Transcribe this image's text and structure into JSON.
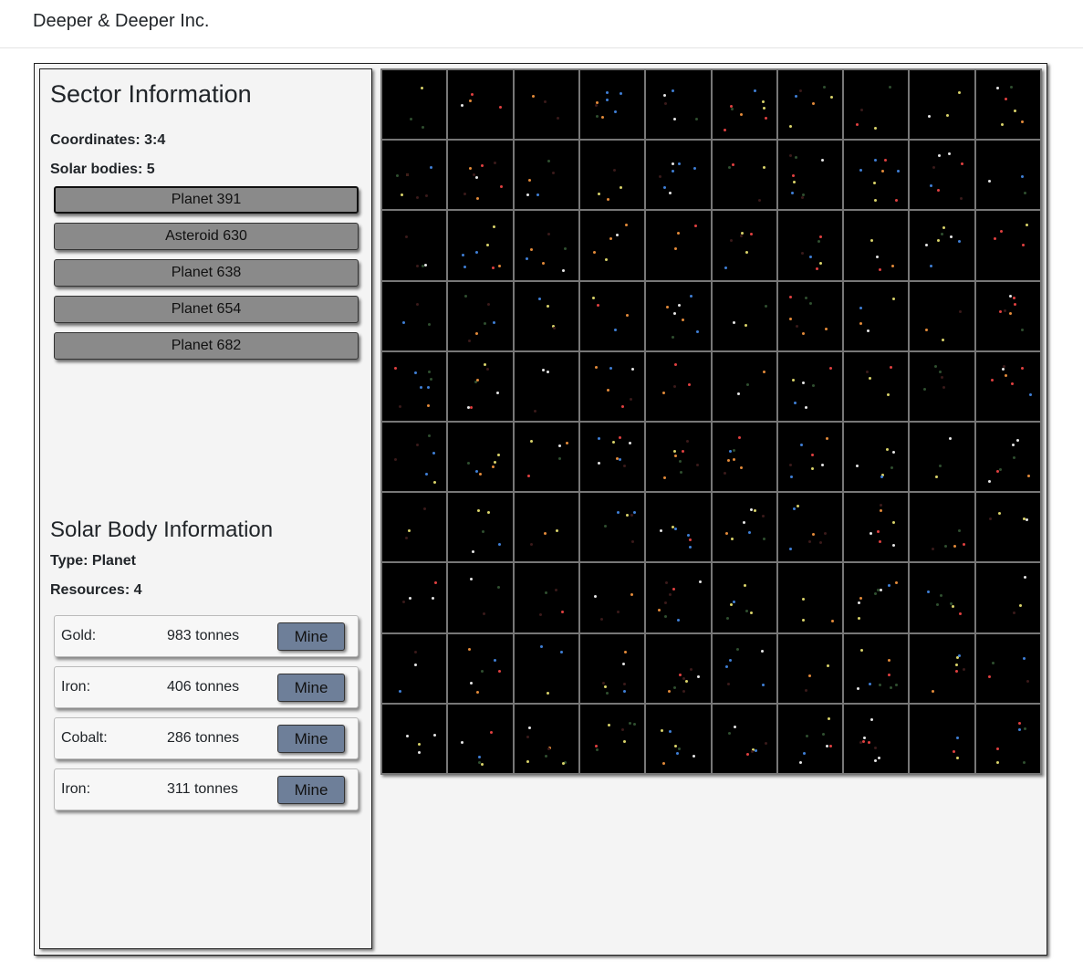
{
  "app": {
    "title": "Deeper & Deeper Inc."
  },
  "sector": {
    "heading": "Sector Information",
    "coordinates": "Coordinates: 3:4",
    "solar_bodies": "Solar bodies: 5",
    "bodies": [
      {
        "label": "Planet 391",
        "selected": true
      },
      {
        "label": "Asteroid 630",
        "selected": false
      },
      {
        "label": "Planet 638",
        "selected": false
      },
      {
        "label": "Planet 654",
        "selected": false
      },
      {
        "label": "Planet 682",
        "selected": false
      }
    ]
  },
  "solar_body": {
    "heading": "Solar Body Information",
    "type": "Type: Planet",
    "resources_count": "Resources: 4",
    "resources": [
      {
        "name": "Gold:",
        "amount": "983 tonnes",
        "action": "Mine"
      },
      {
        "name": "Iron:",
        "amount": "406 tonnes",
        "action": "Mine"
      },
      {
        "name": "Cobalt:",
        "amount": "286 tonnes",
        "action": "Mine"
      },
      {
        "name": "Iron:",
        "amount": "311 tonnes",
        "action": "Mine"
      }
    ]
  },
  "map": {
    "columns": 10,
    "rows": 10,
    "star_colors": [
      "#e6e6e6",
      "#e04040",
      "#3f7fd6",
      "#d9d36a",
      "#e38a3a",
      "#2f4f2f",
      "#3a1a1a"
    ]
  }
}
